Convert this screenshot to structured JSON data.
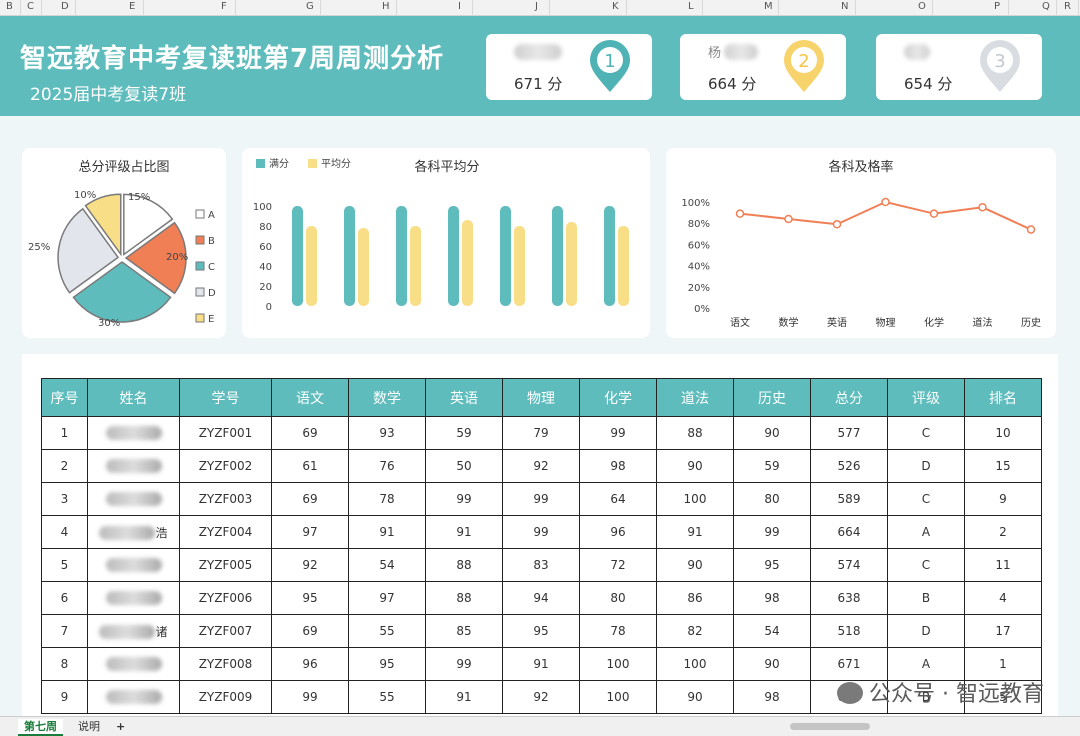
{
  "header": {
    "title": "智远教育中考复读班第7周周测分析",
    "subtitle": "2025届中考复读7班"
  },
  "columns": [
    "B",
    "C",
    "D",
    "E",
    "F",
    "G",
    "H",
    "I",
    "J",
    "K",
    "L",
    "M",
    "N",
    "O",
    "P",
    "Q",
    "R"
  ],
  "top3": [
    {
      "name_visible": "",
      "score": "671 分",
      "rank": "1",
      "color": "#4fb3b5"
    },
    {
      "name_visible": "杨",
      "score": "664 分",
      "rank": "2",
      "color": "#f6d36b"
    },
    {
      "name_visible": "",
      "score": "654 分",
      "rank": "3",
      "color": "#d9dde2"
    }
  ],
  "charts": {
    "pie": {
      "title": "总分评级占比图",
      "chart_data": {
        "type": "pie",
        "categories": [
          "A",
          "B",
          "C",
          "D",
          "E"
        ],
        "values": [
          15,
          20,
          30,
          25,
          10
        ],
        "labels": [
          "15%",
          "20%",
          "30%",
          "25%",
          "10%"
        ],
        "colors": [
          "#ffffff",
          "#f07f55",
          "#5fbcbd",
          "#e2e6ec",
          "#f8de86"
        ]
      }
    },
    "bar": {
      "title": "各科平均分",
      "legend": [
        "满分",
        "平均分"
      ],
      "chart_data": {
        "type": "bar",
        "categories": [
          "",
          "",
          "",
          "",
          "",
          "",
          ""
        ],
        "ylim": [
          0,
          100
        ],
        "yticks": [
          "100",
          "80",
          "60",
          "40",
          "20",
          "0"
        ],
        "series": [
          {
            "name": "满分",
            "color": "#5fbcbd",
            "values": [
              100,
              100,
              100,
              100,
              100,
              100,
              100
            ]
          },
          {
            "name": "平均分",
            "color": "#f8de86",
            "values": [
              80,
              78,
              80,
              86,
              80,
              84,
              80
            ]
          }
        ]
      }
    },
    "line": {
      "title": "各科及格率",
      "chart_data": {
        "type": "line",
        "categories": [
          "语文",
          "数学",
          "英语",
          "物理",
          "化学",
          "道法",
          "历史"
        ],
        "ylim": [
          0,
          100
        ],
        "yticks": [
          "100%",
          "80%",
          "60%",
          "40%",
          "20%",
          "0%"
        ],
        "values": [
          89,
          84,
          79,
          100,
          89,
          95,
          74
        ],
        "color": "#f07f55"
      }
    }
  },
  "table": {
    "headers": [
      "序号",
      "姓名",
      "学号",
      "语文",
      "数学",
      "英语",
      "物理",
      "化学",
      "道法",
      "历史",
      "总分",
      "评级",
      "排名"
    ],
    "rows": [
      [
        "1",
        "",
        "ZYZF001",
        "69",
        "93",
        "59",
        "79",
        "99",
        "88",
        "90",
        "577",
        "C",
        "10"
      ],
      [
        "2",
        "",
        "ZYZF002",
        "61",
        "76",
        "50",
        "92",
        "98",
        "90",
        "59",
        "526",
        "D",
        "15"
      ],
      [
        "3",
        "",
        "ZYZF003",
        "69",
        "78",
        "99",
        "99",
        "64",
        "100",
        "80",
        "589",
        "C",
        "9"
      ],
      [
        "4",
        "浩",
        "ZYZF004",
        "97",
        "91",
        "91",
        "99",
        "96",
        "91",
        "99",
        "664",
        "A",
        "2"
      ],
      [
        "5",
        "",
        "ZYZF005",
        "92",
        "54",
        "88",
        "83",
        "72",
        "90",
        "95",
        "574",
        "C",
        "11"
      ],
      [
        "6",
        "",
        "ZYZF006",
        "95",
        "97",
        "88",
        "94",
        "80",
        "86",
        "98",
        "638",
        "B",
        "4"
      ],
      [
        "7",
        "诸",
        "ZYZF007",
        "69",
        "55",
        "85",
        "95",
        "78",
        "82",
        "54",
        "518",
        "D",
        "17"
      ],
      [
        "8",
        "",
        "ZYZF008",
        "96",
        "95",
        "99",
        "91",
        "100",
        "100",
        "90",
        "671",
        "A",
        "1"
      ],
      [
        "9",
        "",
        "ZYZF009",
        "99",
        "55",
        "91",
        "92",
        "100",
        "90",
        "98",
        "625",
        "B",
        "5"
      ]
    ]
  },
  "tabs": [
    "第七周",
    "说明",
    "+"
  ],
  "watermark": "公众号 · 智远教育"
}
